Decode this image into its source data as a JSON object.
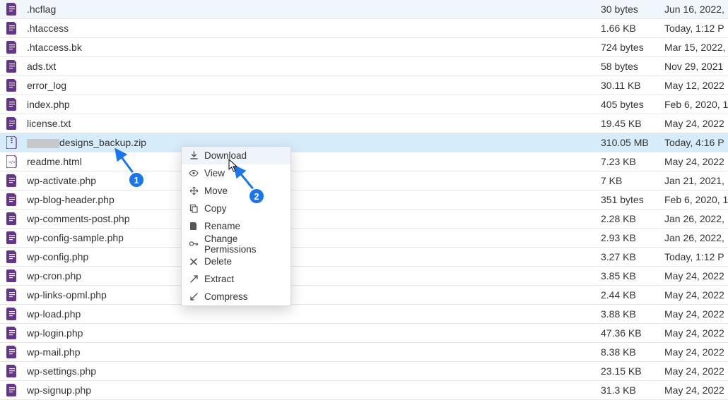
{
  "files": [
    {
      "name": ".hcflag",
      "size": "30 bytes",
      "date": "Jun 16, 2022,",
      "type": "file"
    },
    {
      "name": ".htaccess",
      "size": "1.66 KB",
      "date": "Today, 1:12 P",
      "type": "file"
    },
    {
      "name": ".htaccess.bk",
      "size": "724 bytes",
      "date": "Mar 15, 2022,",
      "type": "file"
    },
    {
      "name": "ads.txt",
      "size": "58 bytes",
      "date": "Nov 29, 2021",
      "type": "file"
    },
    {
      "name": "error_log",
      "size": "30.11 KB",
      "date": "May 12, 2022",
      "type": "file"
    },
    {
      "name": "index.php",
      "size": "405 bytes",
      "date": "Feb 6, 2020, 1",
      "type": "file"
    },
    {
      "name": "license.txt",
      "size": "19.45 KB",
      "date": "May 24, 2022",
      "type": "file"
    },
    {
      "name": "designs_backup.zip",
      "size": "310.05 MB",
      "date": "Today, 4:16 P",
      "type": "zip",
      "selected": true,
      "redacted_prefix": true
    },
    {
      "name": "readme.html",
      "size": "7.23 KB",
      "date": "May 24, 2022",
      "type": "html"
    },
    {
      "name": "wp-activate.php",
      "size": "7 KB",
      "date": "Jan 21, 2021,",
      "type": "file"
    },
    {
      "name": "wp-blog-header.php",
      "size": "351 bytes",
      "date": "Feb 6, 2020, 1",
      "type": "file"
    },
    {
      "name": "wp-comments-post.php",
      "size": "2.28 KB",
      "date": "Jan 26, 2022,",
      "type": "file"
    },
    {
      "name": "wp-config-sample.php",
      "size": "2.93 KB",
      "date": "Jan 26, 2022,",
      "type": "file"
    },
    {
      "name": "wp-config.php",
      "size": "3.27 KB",
      "date": "Today, 1:12 P",
      "type": "file"
    },
    {
      "name": "wp-cron.php",
      "size": "3.85 KB",
      "date": "May 24, 2022",
      "type": "file"
    },
    {
      "name": "wp-links-opml.php",
      "size": "2.44 KB",
      "date": "May 24, 2022",
      "type": "file"
    },
    {
      "name": "wp-load.php",
      "size": "3.88 KB",
      "date": "May 24, 2022",
      "type": "file"
    },
    {
      "name": "wp-login.php",
      "size": "47.36 KB",
      "date": "May 24, 2022",
      "type": "file"
    },
    {
      "name": "wp-mail.php",
      "size": "8.38 KB",
      "date": "May 24, 2022",
      "type": "file"
    },
    {
      "name": "wp-settings.php",
      "size": "23.15 KB",
      "date": "May 24, 2022",
      "type": "file"
    },
    {
      "name": "wp-signup.php",
      "size": "31.3 KB",
      "date": "May 24, 2022",
      "type": "file"
    }
  ],
  "context_menu": {
    "items": [
      {
        "label": "Download",
        "icon": "download-icon",
        "highlight": true
      },
      {
        "label": "View",
        "icon": "eye-icon"
      },
      {
        "label": "Move",
        "icon": "move-icon"
      },
      {
        "label": "Copy",
        "icon": "copy-icon"
      },
      {
        "label": "Rename",
        "icon": "rename-icon"
      },
      {
        "label": "Change Permissions",
        "icon": "key-icon"
      },
      {
        "label": "Delete",
        "icon": "delete-icon"
      },
      {
        "label": "Extract",
        "icon": "extract-icon"
      },
      {
        "label": "Compress",
        "icon": "compress-icon"
      }
    ]
  },
  "callouts": {
    "c1": "1",
    "c2": "2"
  },
  "colors": {
    "accent": "#1976f0",
    "file_icon": "#64348f"
  }
}
